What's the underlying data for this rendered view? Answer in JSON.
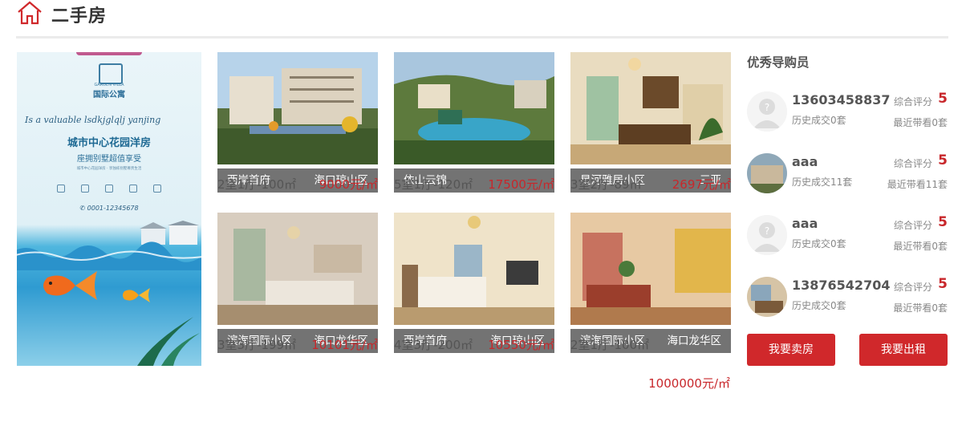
{
  "section": {
    "title": "二手房"
  },
  "ad": {
    "brand": "国际公寓",
    "logo_sub": "GARDEN VILLA",
    "script": "Is a valuable lsdkjglqlj yanjing",
    "headline": "城市中心花园洋房",
    "subline": "座拥别墅超值享受",
    "small_text": "城市中心花园洋房 · 享独栋别墅尊贵生活",
    "phone": "0001-12345678"
  },
  "listings": [
    {
      "name": "西岸首府",
      "district": "海口琼山区",
      "spec": "2室1厅-100㎡",
      "price": "9000元/㎡"
    },
    {
      "name": "依山云锦",
      "district": "",
      "spec": "5室1厅-120㎡",
      "price": "17500元/㎡"
    },
    {
      "name": "星河雅居小区",
      "district": "三亚",
      "spec": "3室2厅-89㎡",
      "price": "2697元/㎡"
    },
    {
      "name": "滨海国际小区",
      "district": "海口龙华区",
      "spec": "3室3厅-199㎡",
      "price": "10101元/㎡"
    },
    {
      "name": "西岸首府",
      "district": "海口琼山区",
      "spec": "4室3厅-200㎡",
      "price": "10550元/㎡"
    },
    {
      "name": "滨海国际小区",
      "district": "海口龙华区",
      "spec": "2室1厅-100㎡",
      "price": "1000000元/㎡"
    }
  ],
  "agents_title": "优秀导购员",
  "agents": [
    {
      "name": "13603458837",
      "history": "历史成交0套",
      "rating_label": "综合评分",
      "rating": "5",
      "recent": "最近带看0套",
      "avatar": "placeholder"
    },
    {
      "name": "aaa",
      "history": "历史成交11套",
      "rating_label": "综合评分",
      "rating": "5",
      "recent": "最近带看11套",
      "avatar": "photo"
    },
    {
      "name": "aaa",
      "history": "历史成交0套",
      "rating_label": "综合评分",
      "rating": "5",
      "recent": "最近带看0套",
      "avatar": "placeholder"
    },
    {
      "name": "13876542704",
      "history": "历史成交0套",
      "rating_label": "综合评分",
      "rating": "5",
      "recent": "最近带看0套",
      "avatar": "photo"
    }
  ],
  "buttons": {
    "sell": "我要卖房",
    "rent": "我要出租"
  },
  "colors": {
    "accent": "#d0282b",
    "price": "#c8272b"
  }
}
